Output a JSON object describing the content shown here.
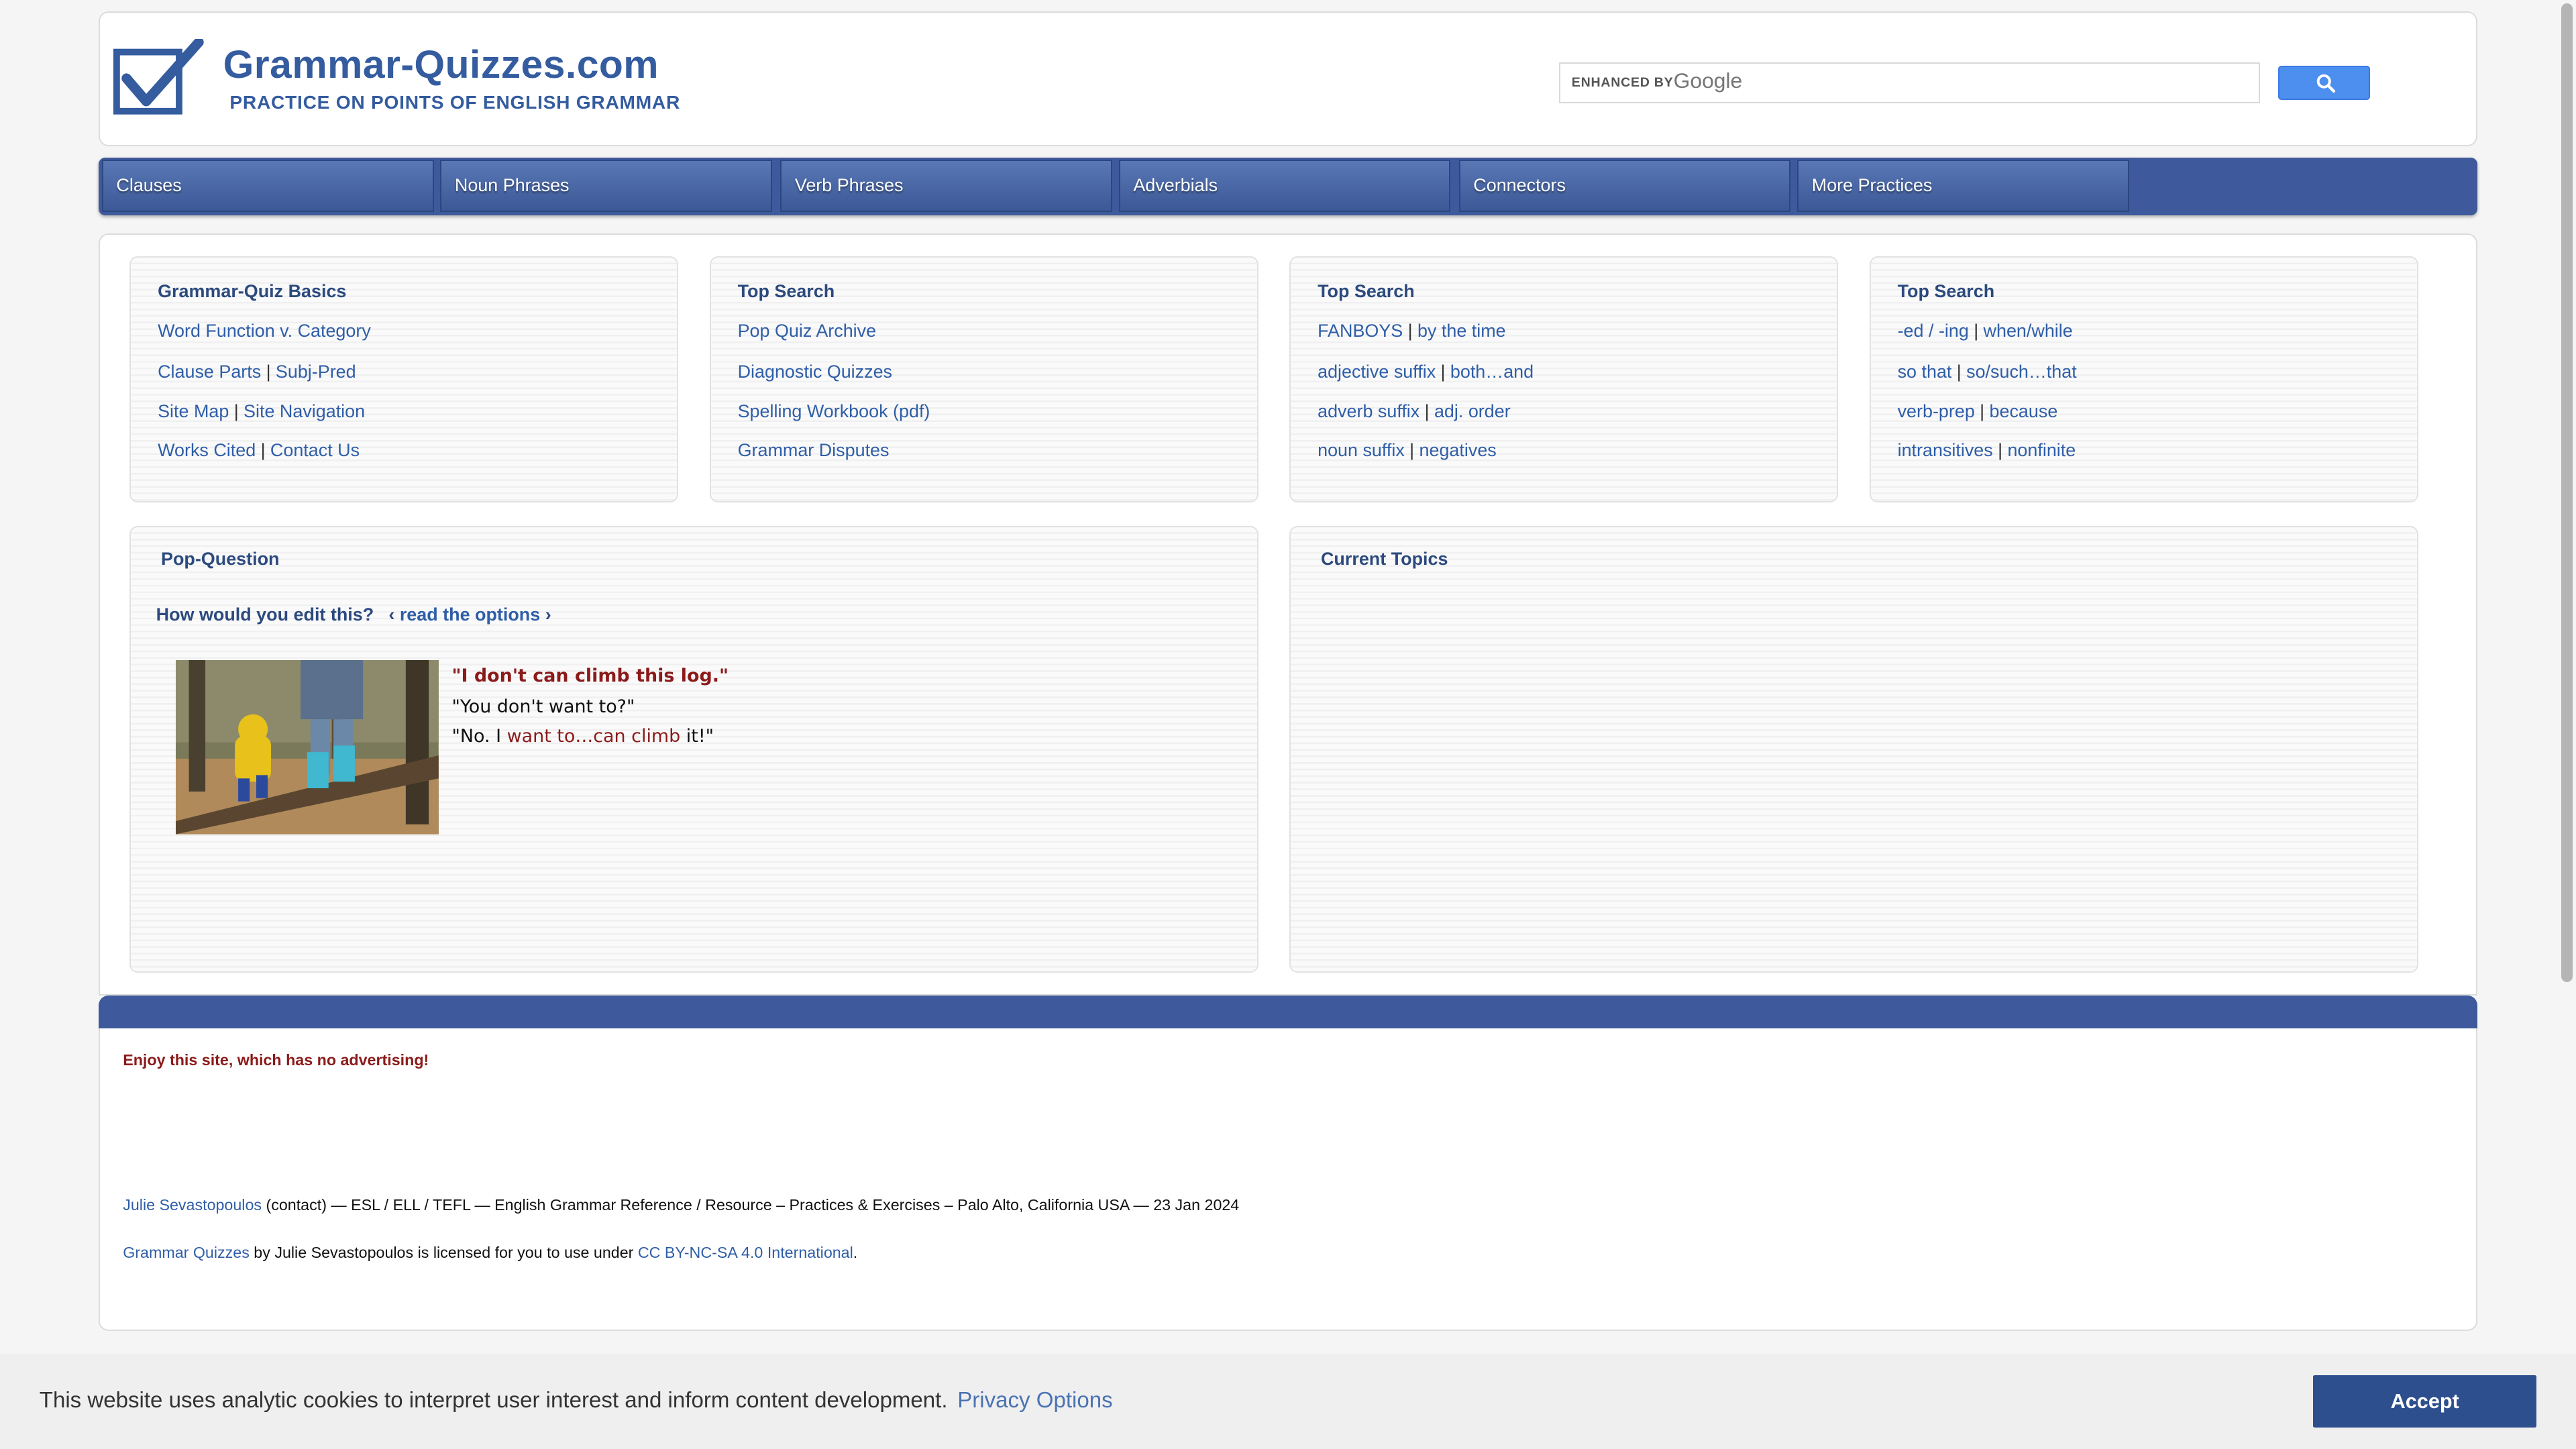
{
  "header": {
    "site_title": "Grammar-Quizzes.com",
    "tagline": "PRACTICE ON POINTS OF ENGLISH GRAMMAR",
    "search_enhanced": "ENHANCED BY",
    "search_google": "Google",
    "search_icon": "magnifier-icon"
  },
  "nav": {
    "items": [
      "Clauses",
      "Noun Phrases",
      "Verb Phrases",
      "Adverbials",
      "Connectors",
      "More Practices"
    ]
  },
  "panels": {
    "basics": {
      "title": "Grammar-Quiz Basics",
      "rows": [
        [
          "Word Function v. Category"
        ],
        [
          "Clause Parts",
          "Subj-Pred"
        ],
        [
          "Site Map",
          "Site Navigation"
        ],
        [
          "Works Cited",
          "Contact Us"
        ]
      ]
    },
    "top1": {
      "title": "Top Search",
      "rows": [
        [
          "Pop Quiz Archive"
        ],
        [
          "Diagnostic Quizzes"
        ],
        [
          "Spelling Workbook (pdf)"
        ],
        [
          "Grammar Disputes"
        ]
      ]
    },
    "top2": {
      "title": "Top Search",
      "rows": [
        [
          "FANBOYS",
          "by the time"
        ],
        [
          "adjective suffix",
          "both…and"
        ],
        [
          "adverb suffix",
          "adj. order"
        ],
        [
          "noun suffix",
          "negatives"
        ]
      ]
    },
    "top3": {
      "title": "Top Search",
      "rows": [
        [
          "-ed / -ing",
          "when/while"
        ],
        [
          "so that",
          "so/such…that"
        ],
        [
          "verb-prep",
          "because"
        ],
        [
          "intransitives",
          "nonfinite"
        ]
      ]
    }
  },
  "pop": {
    "title": "Pop-Question",
    "question": "How would you edit this?",
    "read_prefix": "‹",
    "read_link": "read the options",
    "read_suffix": "›",
    "line1": "\"I don't can climb this log.\"",
    "line2": "\"You don't want to?\"",
    "line3_a": "\"No. I ",
    "line3_b": "want to…can climb",
    "line3_c": " it!\""
  },
  "current": {
    "title": "Current Topics"
  },
  "footer": {
    "note": "Enjoy this site, which has no advertising!",
    "author_link": "Julie Sevastopoulos",
    "author_rest": " (contact) — ESL / ELL / TEFL — English Grammar Reference / Resource – Practices & Exercises – Palo Alto, California USA — 23 Jan 2024",
    "license_link": "Grammar Quizzes",
    "license_mid": " by Julie Sevastopoulos is licensed for you to use under ",
    "license_cc": "CC BY-NC-SA 4.0 International",
    "license_end": "."
  },
  "cookie": {
    "text": "This website uses analytic cookies to interpret user interest and inform content development.",
    "privacy": "Privacy Options",
    "accept": "Accept"
  },
  "colors": {
    "brand_blue": "#345c9f",
    "nav_blue": "#3e5a9c",
    "accent_red": "#8b1a1a",
    "link_blue": "#2f5ea8"
  }
}
